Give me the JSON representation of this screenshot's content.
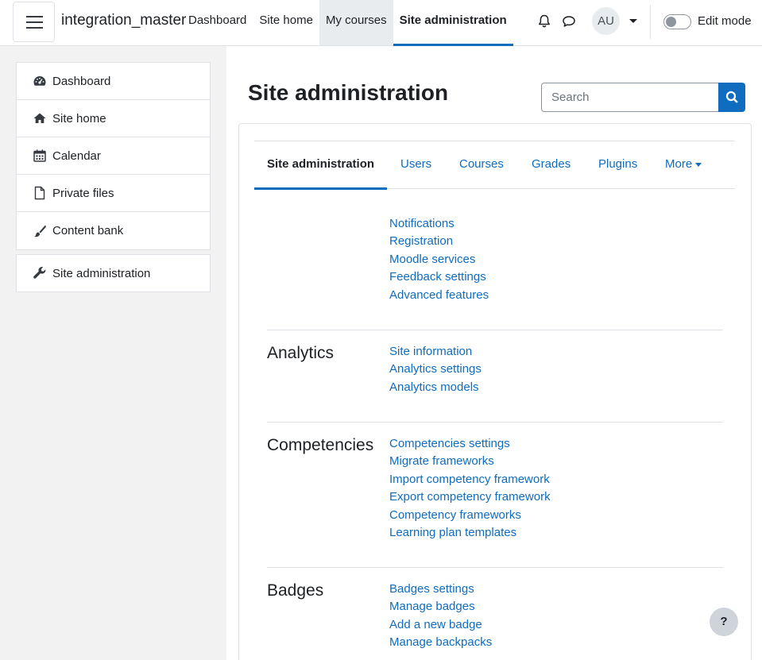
{
  "navbar": {
    "site_name": "integration_master",
    "items": [
      {
        "label": "Dashboard"
      },
      {
        "label": "Site home"
      },
      {
        "label": "My courses"
      },
      {
        "label": "Site administration"
      }
    ],
    "avatar_initials": "AU",
    "edit_mode_label": "Edit mode",
    "icons": [
      "bell-icon",
      "chat-icon",
      "chevron-down-icon"
    ]
  },
  "drawer": {
    "items": [
      {
        "label": "Dashboard",
        "icon": "dashboard-icon"
      },
      {
        "label": "Site home",
        "icon": "home-icon"
      },
      {
        "label": "Calendar",
        "icon": "calendar-icon"
      },
      {
        "label": "Private files",
        "icon": "file-icon"
      },
      {
        "label": "Content bank",
        "icon": "brush-icon"
      }
    ],
    "admin_item": {
      "label": "Site administration",
      "icon": "wrench-icon"
    }
  },
  "main": {
    "title": "Site administration",
    "search_placeholder": "Search",
    "tabs": [
      {
        "label": "Site administration"
      },
      {
        "label": "Users"
      },
      {
        "label": "Courses"
      },
      {
        "label": "Grades"
      },
      {
        "label": "Plugins"
      },
      {
        "label": "More"
      }
    ],
    "sections": [
      {
        "title": "",
        "links": [
          "Notifications",
          "Registration",
          "Moodle services",
          "Feedback settings",
          "Advanced features"
        ]
      },
      {
        "title": "Analytics",
        "links": [
          "Site information",
          "Analytics settings",
          "Analytics models"
        ]
      },
      {
        "title": "Competencies",
        "links": [
          "Competencies settings",
          "Migrate frameworks",
          "Import competency framework",
          "Export competency framework",
          "Competency frameworks",
          "Learning plan templates"
        ]
      },
      {
        "title": "Badges",
        "links": [
          "Badges settings",
          "Manage badges",
          "Add a new badge",
          "Manage backpacks"
        ]
      }
    ]
  },
  "help_label": "?",
  "colors": {
    "link": "#0f6cbf",
    "text": "#1d2125",
    "drawer_bg": "#f2f2f2",
    "border": "#dee2e6"
  }
}
